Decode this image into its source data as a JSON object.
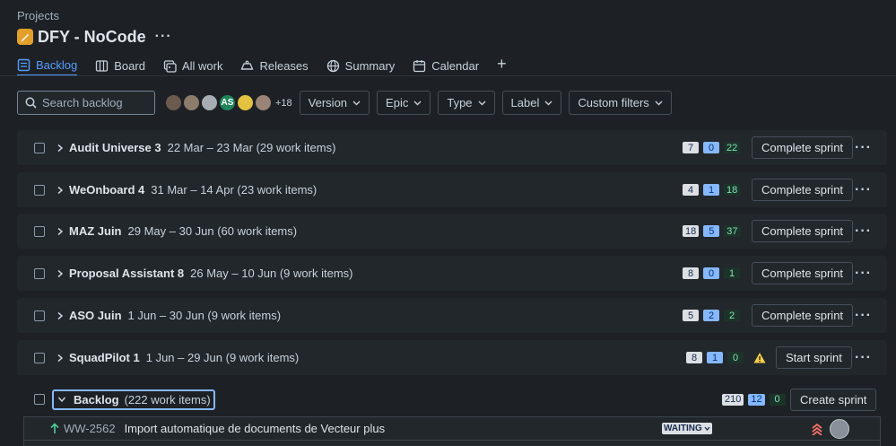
{
  "breadcrumb": "Projects",
  "title": "DFY - NoCode",
  "tabs": [
    {
      "label": "Backlog",
      "icon": "backlog-icon"
    },
    {
      "label": "Board",
      "icon": "board-icon"
    },
    {
      "label": "All work",
      "icon": "all-work-icon"
    },
    {
      "label": "Releases",
      "icon": "releases-icon"
    },
    {
      "label": "Summary",
      "icon": "globe-icon"
    },
    {
      "label": "Calendar",
      "icon": "calendar-icon"
    }
  ],
  "search": {
    "placeholder": "Search backlog"
  },
  "avatars": {
    "initials": "AS",
    "more": "+18"
  },
  "filters": [
    "Version",
    "Epic",
    "Type",
    "Label",
    "Custom filters"
  ],
  "sprints": [
    {
      "name": "Audit Universe 3",
      "dates": "22 Mar – 23 Mar (29 work items)",
      "todo": "7",
      "prog": "0",
      "done": "22",
      "action": "Complete sprint"
    },
    {
      "name": "WeOnboard 4",
      "dates": "31 Mar – 14 Apr (23 work items)",
      "todo": "4",
      "prog": "1",
      "done": "18",
      "action": "Complete sprint"
    },
    {
      "name": "MAZ Juin",
      "dates": "29 May – 30 Jun (60 work items)",
      "todo": "18",
      "prog": "5",
      "done": "37",
      "action": "Complete sprint"
    },
    {
      "name": "Proposal Assistant 8",
      "dates": "26 May – 10 Jun (9 work items)",
      "todo": "8",
      "prog": "0",
      "done": "1",
      "action": "Complete sprint"
    },
    {
      "name": "ASO Juin",
      "dates": "1 Jun – 30 Jun (9 work items)",
      "todo": "5",
      "prog": "2",
      "done": "2",
      "action": "Complete sprint"
    },
    {
      "name": "SquadPilot 1",
      "dates": "1 Jun – 29 Jun (9 work items)",
      "todo": "8",
      "prog": "1",
      "done": "0",
      "action": "Start sprint"
    }
  ],
  "backlog": {
    "name": "Backlog",
    "count": "(222 work items)",
    "todo": "210",
    "prog": "12",
    "done": "0",
    "action": "Create sprint"
  },
  "issues": [
    {
      "key": "WW-2562",
      "summary": "Import automatique de documents de Vecteur plus",
      "status": "WAITING"
    }
  ],
  "colors": {
    "accent": "#579dff",
    "background": "#1d2125",
    "surface": "#22272b",
    "project_icon": "#e2a02a"
  }
}
